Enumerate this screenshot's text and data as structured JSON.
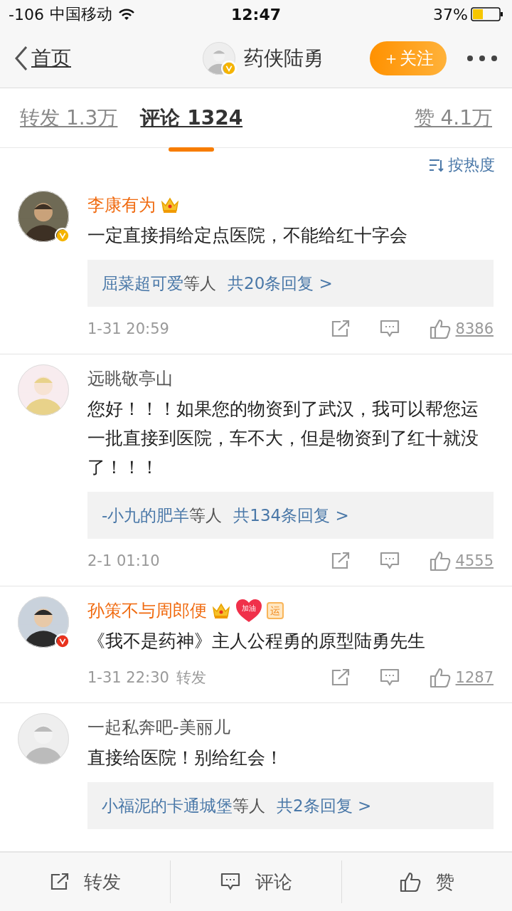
{
  "status_bar": {
    "signal": "-106",
    "carrier": "中国移动",
    "time": "12:47",
    "battery": "37%"
  },
  "nav": {
    "back": "首页",
    "title": "药侠陆勇",
    "verified": {
      "color": "#f5b400"
    },
    "follow": "＋关注"
  },
  "tabs": [
    {
      "label": "转发 1.3万",
      "selected": false
    },
    {
      "label": "评论 1324",
      "selected": true
    },
    {
      "label": "赞 4.1万",
      "selected": false
    }
  ],
  "sort": "按热度",
  "comments": [
    {
      "user": "李康有为",
      "vip": true,
      "verified": {
        "color": "#f5b400"
      },
      "badges": [
        {
          "kind": "crown"
        }
      ],
      "text": "一定直接捐给定点医院，不能给红十字会",
      "replies": {
        "names": "屈菜超可爱",
        "others": "等人",
        "count": "共20条回复 >"
      },
      "time": "1-31 20:59",
      "likes": "8386"
    },
    {
      "user": "远眺敬亭山",
      "vip": false,
      "text": "您好！！！如果您的物资到了武汉，我可以帮您运一批直接到医院，车不大，但是物资到了红十就没了！！！",
      "replies": {
        "names": "-小九的肥羊",
        "others": "等人",
        "count": "共134条回复 >"
      },
      "time": "2-1 01:10",
      "likes": "4555"
    },
    {
      "user": "孙策不与周郎便",
      "vip": true,
      "verified": {
        "color": "#e8321e"
      },
      "badges": [
        {
          "kind": "crown"
        },
        {
          "kind": "heart",
          "text": "加油"
        },
        {
          "kind": "tag",
          "text": "运"
        }
      ],
      "text": "《我不是药神》主人公程勇的原型陆勇先生",
      "time": "1-31 22:30",
      "source": "转发",
      "likes": "1287"
    },
    {
      "user": "一起私奔吧-美丽儿",
      "vip": false,
      "text": "直接给医院！别给红会！",
      "replies": {
        "names": "小福泥的卡通城堡",
        "others": "等人",
        "count": "共2条回复 >"
      }
    }
  ],
  "bottom_bar": [
    {
      "kind": "share",
      "label": "转发"
    },
    {
      "kind": "comment",
      "label": "评论"
    },
    {
      "kind": "like",
      "label": "赞"
    }
  ]
}
